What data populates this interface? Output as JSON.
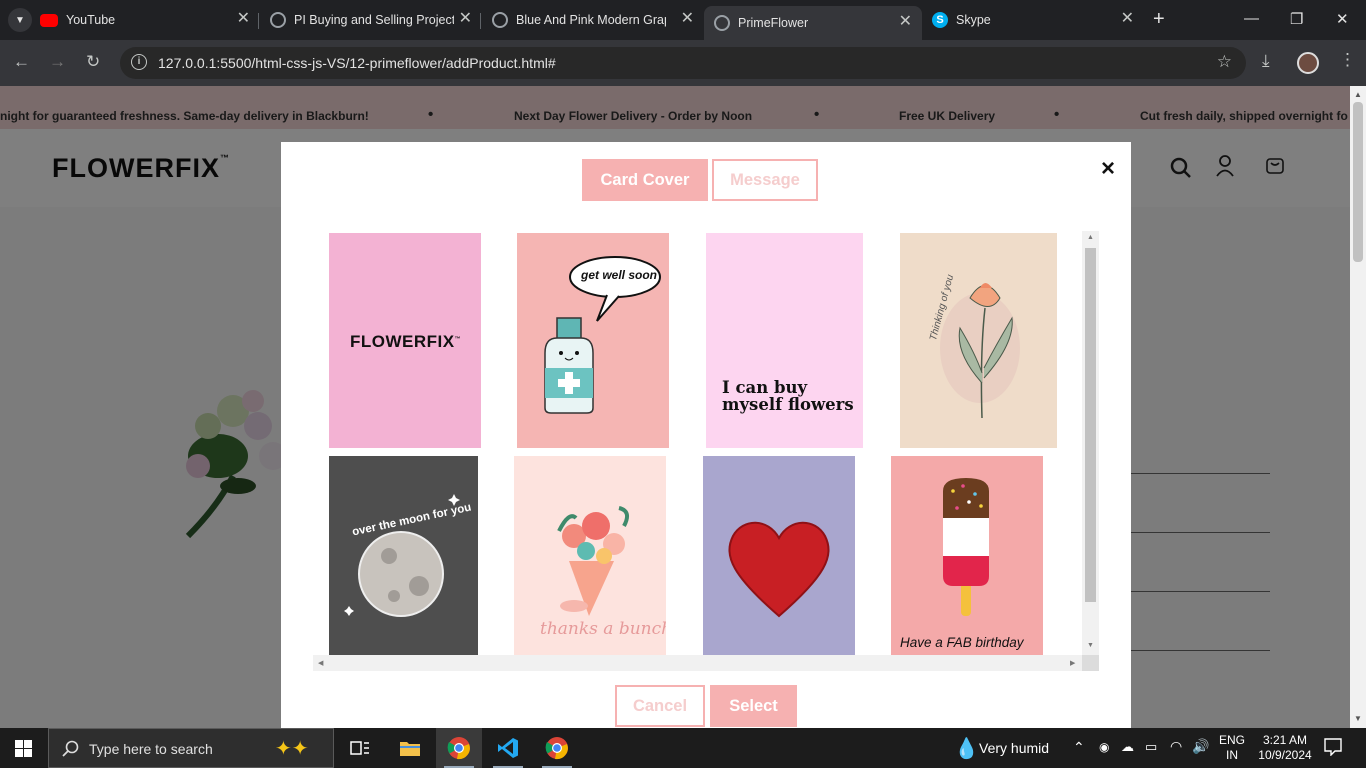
{
  "tabs": [
    {
      "title": "YouTube",
      "icon": "youtube-icon",
      "color": "#ff0000"
    },
    {
      "title": "PI Buying and Selling Project",
      "icon": "globe-icon",
      "color": "#9aa0a6"
    },
    {
      "title": "Blue And Pink Modern Graph",
      "icon": "globe-icon",
      "color": "#9aa0a6"
    },
    {
      "title": "PrimeFlower",
      "icon": "globe-icon",
      "color": "#9aa0a6",
      "active": true
    },
    {
      "title": "Skype",
      "icon": "skype-icon",
      "color": "#00aff0"
    }
  ],
  "toolbar": {
    "url": "127.0.0.1:5500/html-css-js-VS/12-primeflower/addProduct.html#"
  },
  "ticker": {
    "items": [
      "night for guaranteed freshness. Same-day delivery in Blackburn!",
      "Next Day Flower Delivery - Order by Noon",
      "Free UK Delivery",
      "Cut fresh daily, shipped overnight fo"
    ],
    "bullet": "•"
  },
  "site": {
    "logo": "FLOWERFIX",
    "tm": "™"
  },
  "modal": {
    "tabs": {
      "cover": "Card Cover",
      "message": "Message"
    },
    "close": "×",
    "cards": [
      {
        "name": "card-flowerfix",
        "text": "FLOWERFIX",
        "tm": "™",
        "bg": "#f3b2d3"
      },
      {
        "name": "card-get-well-soon",
        "text": "get well soon",
        "bg": "#f5b5b3"
      },
      {
        "name": "card-i-can-buy-myself-flowers",
        "text": "I can buy myself flowers",
        "bg": "#fdd5f0"
      },
      {
        "name": "card-thinking-of-you",
        "text": "Thinking of you",
        "bg": "#efdcc9"
      },
      {
        "name": "card-over-the-moon",
        "text": "over the moon for you",
        "bg": "#4e4e4e"
      },
      {
        "name": "card-thanks-a-bunch",
        "text": "thanks a bunch",
        "bg": "#fde3de"
      },
      {
        "name": "card-heart",
        "text": "",
        "bg": "#a9a6ce"
      },
      {
        "name": "card-fab-birthday",
        "text": "Have a FAB birthday",
        "bg": "#f4a9a9"
      }
    ],
    "buttons": {
      "cancel": "Cancel",
      "select": "Select"
    }
  },
  "taskbar": {
    "search": "Type here to search",
    "weather": "Very humid",
    "lang1": "ENG",
    "lang2": "IN",
    "time": "3:21 AM",
    "date": "10/9/2024"
  }
}
